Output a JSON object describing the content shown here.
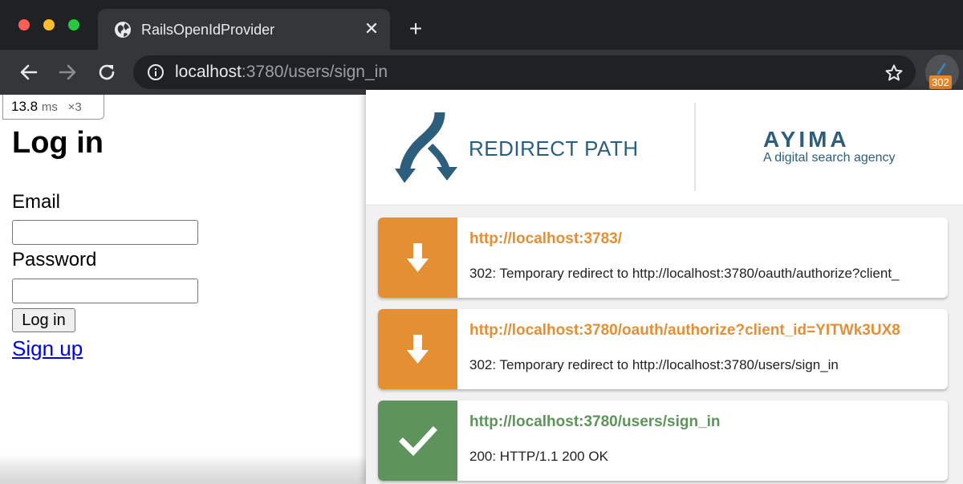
{
  "browser": {
    "tab_title": "RailsOpenIdProvider",
    "url_host": "localhost",
    "url_rest": ":3780/users/sign_in",
    "extension_badge": "302",
    "tab_close_glyph": "✕",
    "new_tab_glyph": "+"
  },
  "perf": {
    "ms_value": "13.8",
    "ms_unit": "ms",
    "count": "×3"
  },
  "login": {
    "title": "Log in",
    "email_label": "Email",
    "email_value": "",
    "password_label": "Password",
    "password_value": "",
    "submit_label": "Log in",
    "signup_link": "Sign up"
  },
  "popup": {
    "brand_name": "REDIRECT PATH",
    "partner_name": "AYIMA",
    "partner_tagline": "A digital search agency",
    "hops": [
      {
        "url": "http://localhost:3783/",
        "status": "302: Temporary redirect to http://localhost:3780/oauth/authorize?client_",
        "kind": "redirect",
        "color": "#e58f35",
        "icon": "arrow-down-icon"
      },
      {
        "url": "http://localhost:3780/oauth/authorize?client_id=YITWk3UX8",
        "status": "302: Temporary redirect to http://localhost:3780/users/sign_in",
        "kind": "redirect",
        "color": "#e58f35",
        "icon": "arrow-down-icon"
      },
      {
        "url": "http://localhost:3780/users/sign_in",
        "status": "200: HTTP/1.1 200 OK",
        "kind": "ok",
        "color": "#5e935c",
        "icon": "checkmark-icon"
      }
    ]
  },
  "colors": {
    "redirect": "#e58f35",
    "ok": "#5e935c",
    "brand": "#2d5f7c",
    "link": "#0000ee"
  }
}
